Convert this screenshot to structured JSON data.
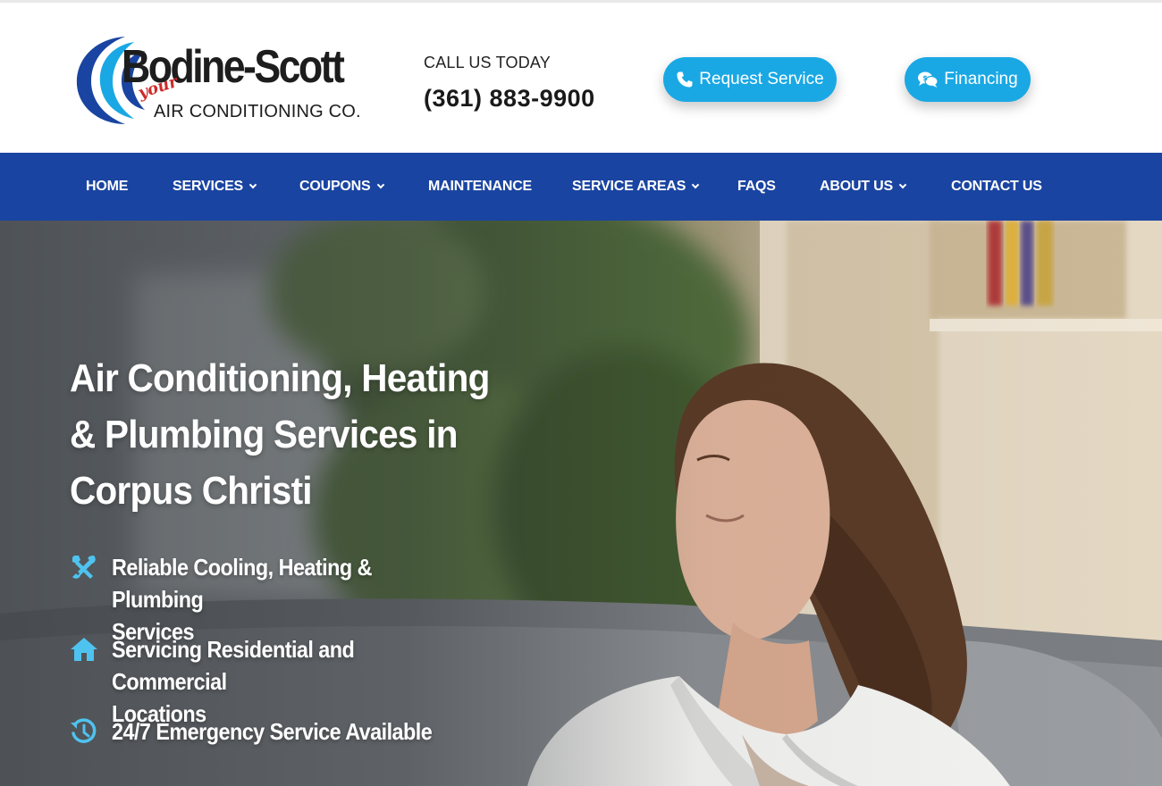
{
  "header": {
    "logo": {
      "name": "Bodine-Scott",
      "tagline": "your",
      "subtitle": "AIR CONDITIONING CO."
    },
    "call_label": "CALL US TODAY",
    "phone": "(361) 883-9900",
    "request_button": {
      "label": "Request Service",
      "icon": "phone-icon"
    },
    "financing_button": {
      "label": "Financing",
      "icon": "chat-bubbles-icon"
    }
  },
  "nav": {
    "items": [
      {
        "label": "HOME",
        "has_dropdown": false
      },
      {
        "label": "SERVICES",
        "has_dropdown": true
      },
      {
        "label": "COUPONS",
        "has_dropdown": true
      },
      {
        "label": "MAINTENANCE",
        "has_dropdown": false
      },
      {
        "label": "SERVICE AREAS",
        "has_dropdown": true
      },
      {
        "label": "FAQS",
        "has_dropdown": false
      },
      {
        "label": "ABOUT US",
        "has_dropdown": true
      },
      {
        "label": "CONTACT US",
        "has_dropdown": false
      }
    ]
  },
  "hero": {
    "title_lines": [
      "Air Conditioning, Heating",
      "& Plumbing Services in",
      "Corpus Christi"
    ],
    "features": [
      {
        "icon": "tools-icon",
        "lines": [
          "Reliable Cooling, Heating & Plumbing",
          "Services"
        ]
      },
      {
        "icon": "home-icon",
        "lines": [
          "Servicing Residential and Commercial",
          "Locations"
        ]
      },
      {
        "icon": "history-clock-icon",
        "lines": [
          "24/7 Emergency Service Available"
        ]
      }
    ]
  },
  "colors": {
    "nav_background": "#1a44a1",
    "accent_button": "#1aa8e4",
    "feature_icon": "#4fc3ef",
    "logo_red": "#cf2a2a"
  }
}
